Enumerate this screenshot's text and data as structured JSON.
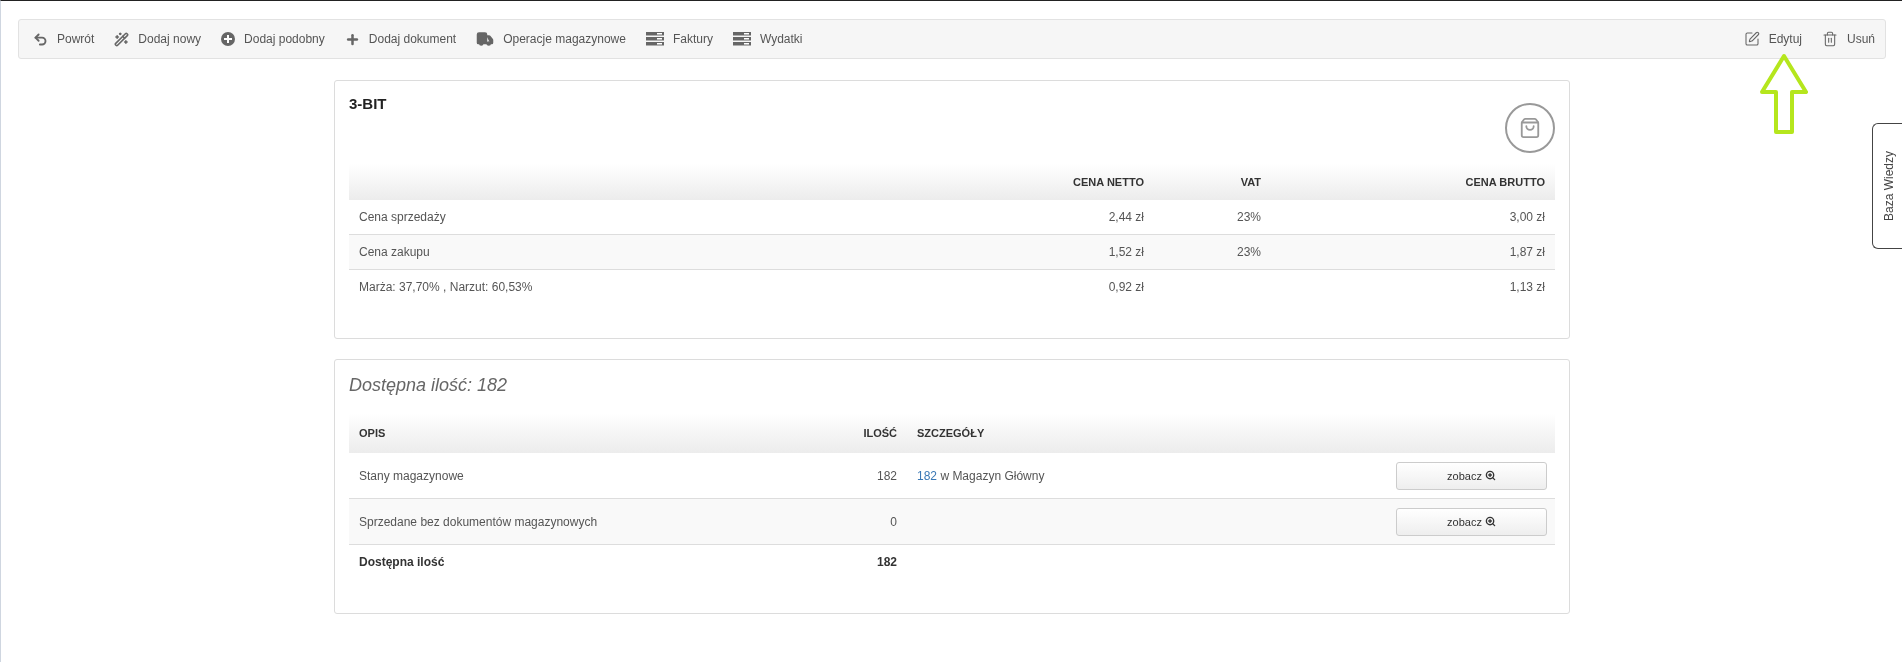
{
  "toolbar": {
    "left": [
      {
        "kind": "back",
        "label": "Powrót"
      },
      {
        "kind": "wand",
        "label": "Dodaj nowy"
      },
      {
        "kind": "plus-circle",
        "label": "Dodaj podobny"
      },
      {
        "kind": "plus",
        "label": "Dodaj dokument"
      },
      {
        "kind": "truck",
        "label": "Operacje magazynowe"
      },
      {
        "kind": "list",
        "label": "Faktury"
      },
      {
        "kind": "list",
        "label": "Wydatki"
      }
    ],
    "right": [
      {
        "kind": "edit",
        "label": "Edytuj"
      },
      {
        "kind": "trash",
        "label": "Usuń"
      }
    ]
  },
  "side_tab": {
    "label": "Baza Wiedzy"
  },
  "price_card": {
    "title": "3-BIT",
    "columns": [
      "",
      "CENA NETTO",
      "VAT",
      "CENA BRUTTO"
    ],
    "rows": [
      [
        "Cena sprzedaży",
        "2,44 zł",
        "23%",
        "3,00 zł"
      ],
      [
        "Cena zakupu",
        "1,52 zł",
        "23%",
        "1,87 zł"
      ],
      [
        "Marża: 37,70% , Narzut: 60,53%",
        "0,92 zł",
        "",
        "1,13 zł"
      ]
    ]
  },
  "stock_card": {
    "title": "Dostępna ilość: 182",
    "columns": [
      "OPIS",
      "ILOŚĆ",
      "SZCZEGÓŁY"
    ],
    "rows": [
      {
        "kind": "item",
        "description": "Stany magazynowe",
        "quantity": "182",
        "detail_link": "182",
        "detail_text": "w Magazyn Główny",
        "button": "zobacz"
      },
      {
        "kind": "item",
        "description": "Sprzedane bez dokumentów magazynowych",
        "quantity": "0",
        "button": "zobacz"
      },
      {
        "kind": "total",
        "description": "Dostępna ilość",
        "quantity": "182"
      }
    ]
  }
}
